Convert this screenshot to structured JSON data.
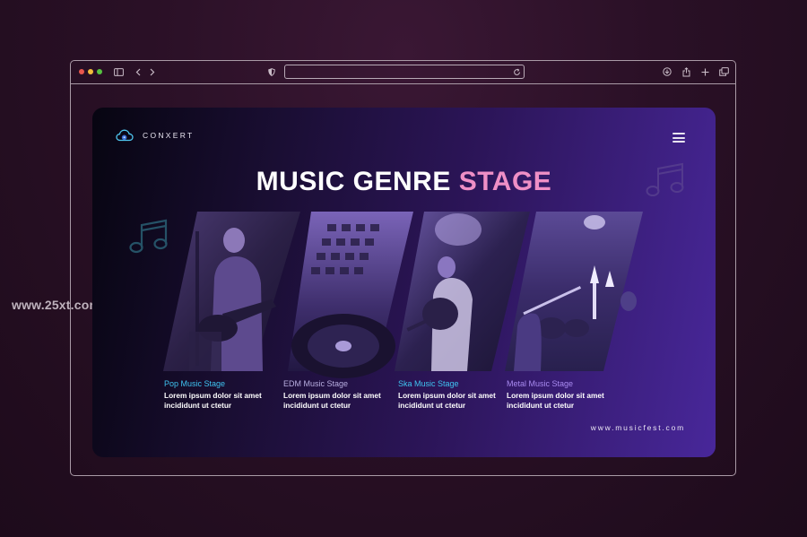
{
  "watermark": "www.25xt.com",
  "browser": {
    "traffic_lights": [
      "close",
      "minimize",
      "maximize"
    ],
    "icons": {
      "sidebar": "sidebar-icon",
      "back": "chevron-left-icon",
      "forward": "chevron-right-icon",
      "shield": "privacy-shield-icon",
      "reload": "reload-icon",
      "download": "download-icon",
      "share": "share-icon",
      "new_tab": "plus-icon",
      "tabs": "tabs-overview-icon"
    },
    "address_value": ""
  },
  "slide": {
    "logo_text": "CONXERT",
    "title_white": "MUSIC GENRE",
    "title_pink": "STAGE",
    "url": "www.musicfest.com",
    "colors": {
      "accent_cyan": "#3fc4f1",
      "accent_pink": "#ef8fc6",
      "accent_purple": "#a88af0"
    },
    "stages": [
      {
        "name": "Pop Music Stage",
        "desc": "Lorem ipsum dolor sit amet incididunt ut ctetur",
        "name_color": "#3fc4f1"
      },
      {
        "name": "EDM Music Stage",
        "desc": "Lorem ipsum dolor sit amet incididunt ut ctetur",
        "name_color": "#b8aee0"
      },
      {
        "name": "Ska Music Stage",
        "desc": "Lorem ipsum dolor sit amet incididunt ut ctetur",
        "name_color": "#3fc4f1"
      },
      {
        "name": "Metal Music Stage",
        "desc": "Lorem ipsum dolor sit amet incididunt ut ctetur",
        "name_color": "#a88af0"
      }
    ]
  }
}
